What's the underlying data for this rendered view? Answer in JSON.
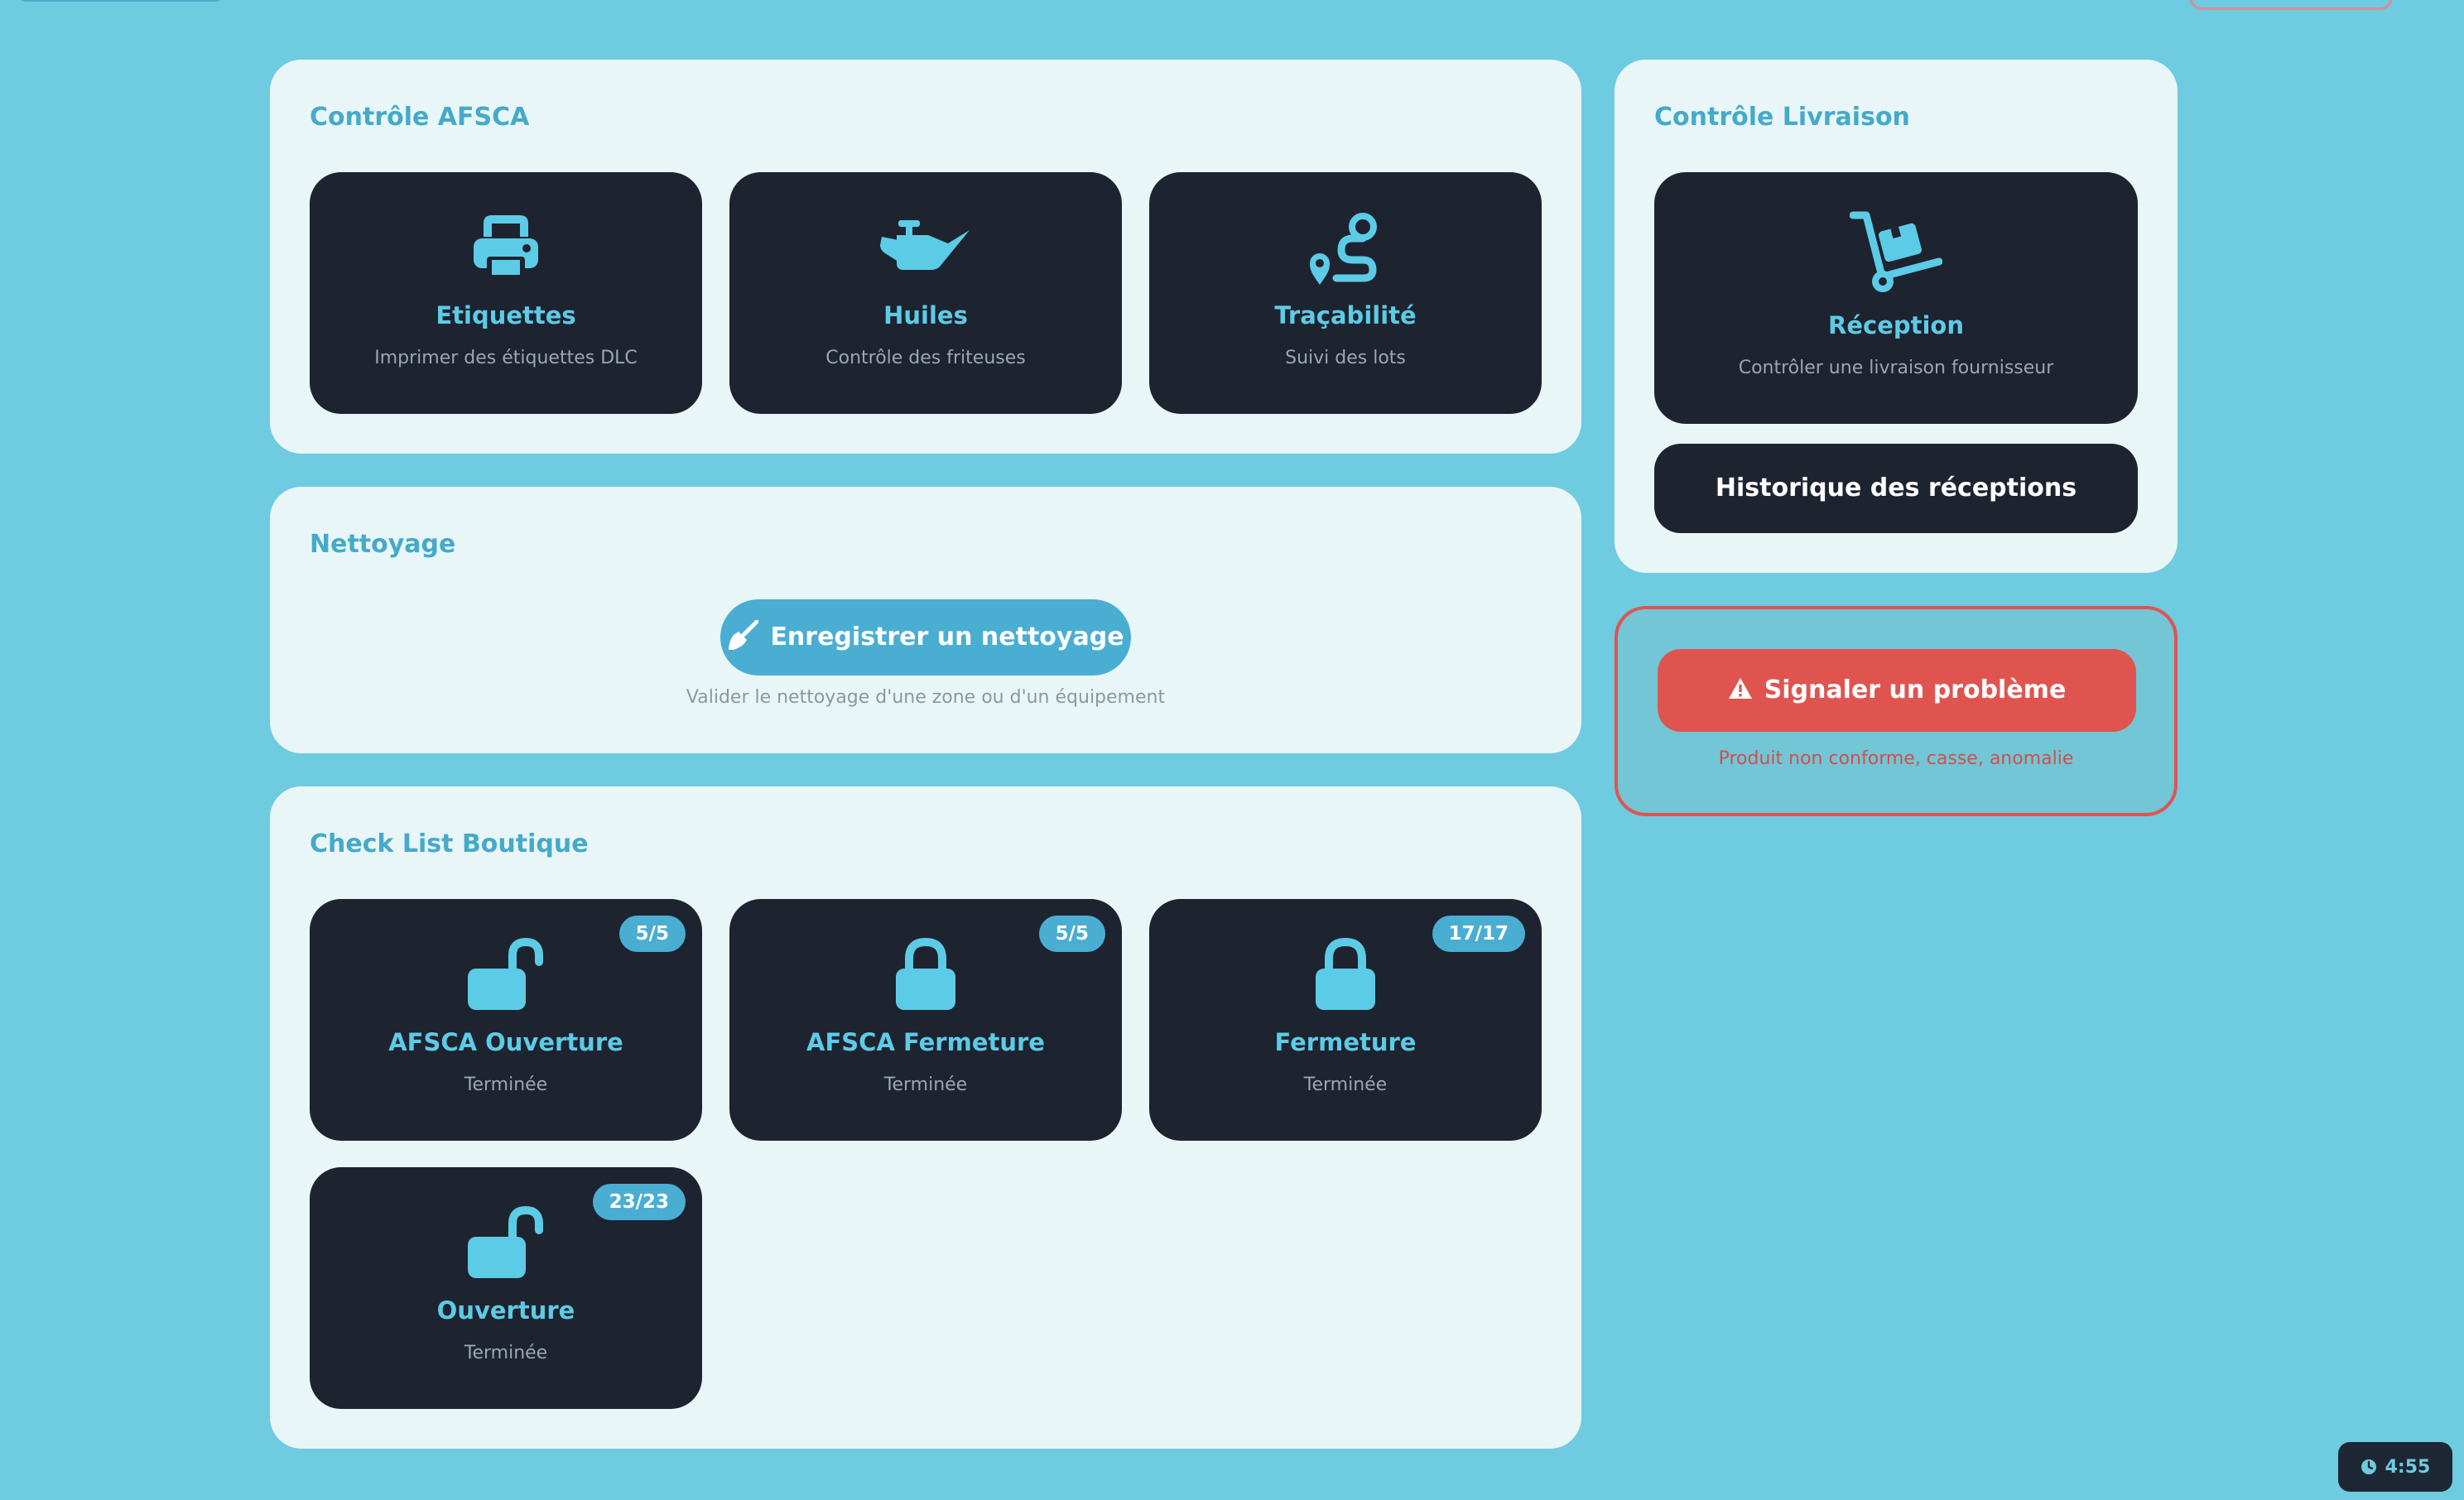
{
  "colors": {
    "background": "#6fcbdf",
    "panel": "#e8f6f8",
    "tile": "#1e2330",
    "accent": "#5ccbe6",
    "heading": "#45aac9",
    "danger": "#e05450"
  },
  "afsca": {
    "title": "Contrôle AFSCA",
    "tiles": [
      {
        "icon": "printer-icon",
        "title": "Etiquettes",
        "subtitle": "Imprimer des étiquettes DLC"
      },
      {
        "icon": "oil-can-icon",
        "title": "Huiles",
        "subtitle": "Contrôle des friteuses"
      },
      {
        "icon": "route-icon",
        "title": "Traçabilité",
        "subtitle": "Suivi des lots"
      }
    ]
  },
  "nettoyage": {
    "title": "Nettoyage",
    "button_label": "Enregistrer un nettoyage",
    "button_icon": "broom-icon",
    "caption": "Valider le nettoyage d'une zone ou d'un équipement"
  },
  "checklist": {
    "title": "Check List Boutique",
    "items": [
      {
        "icon": "lock-open-icon",
        "title": "AFSCA Ouverture",
        "status": "Terminée",
        "badge": "5/5"
      },
      {
        "icon": "lock-icon",
        "title": "AFSCA Fermeture",
        "status": "Terminée",
        "badge": "5/5"
      },
      {
        "icon": "lock-icon",
        "title": "Fermeture",
        "status": "Terminée",
        "badge": "17/17"
      },
      {
        "icon": "lock-open-icon",
        "title": "Ouverture",
        "status": "Terminée",
        "badge": "23/23"
      }
    ]
  },
  "livraison": {
    "title": "Contrôle Livraison",
    "tile_icon": "dolly-icon",
    "tile_title": "Réception",
    "tile_subtitle": "Contrôler une livraison fournisseur",
    "history_label": "Historique des réceptions"
  },
  "probleme": {
    "button_icon": "warning-icon",
    "button_label": "Signaler un problème",
    "caption": "Produit non conforme, casse, anomalie"
  },
  "timer": {
    "icon": "clock-icon",
    "value": "4:55"
  }
}
